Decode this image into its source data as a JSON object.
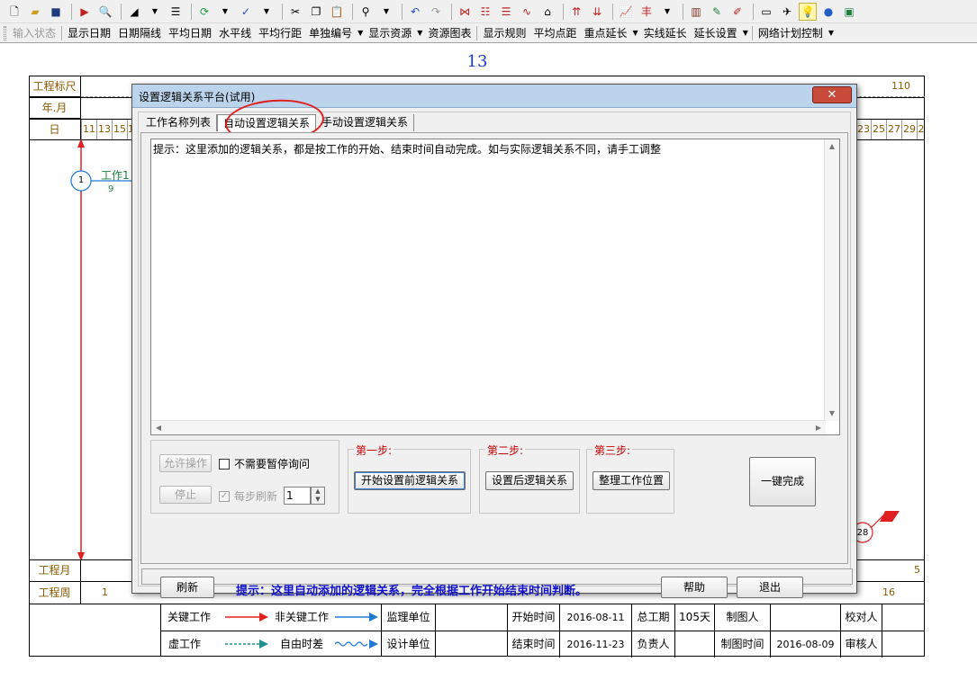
{
  "toolbar2": {
    "items": [
      "输入状态",
      "显示日期",
      "日期隔线",
      "平均日期",
      "水平线",
      "平均行距",
      "单独编号",
      "显示资源",
      "资源图表",
      "显示规则",
      "平均点距",
      "重点延长",
      "实线延长",
      "延长设置",
      "网络计划控制"
    ],
    "dropdown_arrow": "▼"
  },
  "page": {
    "number": "13"
  },
  "schedule": {
    "row_labels": {
      "ruler": "工程标尺",
      "year_month": "年.月",
      "day": "日",
      "month": "工程月",
      "week": "工程周"
    },
    "ruler_end": "110",
    "days_left": [
      "11",
      "13",
      "15",
      "1"
    ],
    "days_right": [
      "23",
      "25",
      "27",
      "29",
      "2"
    ],
    "week_first": "1",
    "week_last": "16",
    "month_last": "5",
    "task_label": "工作1",
    "task_duration": "9",
    "node_start": "1",
    "node_end": "28"
  },
  "legend": {
    "critical_work": "关键工作",
    "noncritical_work": "非关键工作",
    "dummy_work": "虚工作",
    "free_float": "自由时差",
    "supervisor_unit": "监理单位",
    "design_unit": "设计单位",
    "start_time_label": "开始时间",
    "start_time_value": "2016-08-11",
    "end_time_label": "结束时间",
    "end_time_value": "2016-11-23",
    "total_duration_label": "总工期",
    "total_duration_value": "105天",
    "responsible_label": "负责人",
    "drawer_label": "制图人",
    "draw_time_label": "制图时间",
    "draw_time_value": "2016-08-09",
    "checker_label": "校对人",
    "reviewer_label": "审核人"
  },
  "dialog": {
    "title": "设置逻辑关系平台(试用)",
    "close_glyph": "✕",
    "tabs": [
      "工作名称列表",
      "自动设置逻辑关系",
      "手动设置逻辑关系"
    ],
    "message": "提示：这里添加的逻辑关系，都是按工作的开始、结束时间自动完成。如与实际逻辑关系不同，请手工调整",
    "allow_button": "允许操作",
    "stop_button": "停止",
    "no_pause_checkbox": "不需要暂停询问",
    "refresh_each_step_checkbox": "每步刷新",
    "step_count": "1",
    "step1_label": "第一步:",
    "step1_button": "开始设置前逻辑关系",
    "step2_label": "第二步:",
    "step2_button": "设置后逻辑关系",
    "step3_label": "第三步:",
    "step3_button": "整理工作位置",
    "oneclick_button": "一键完成",
    "refresh_button": "刷新",
    "hint": "提示：这里自动添加的逻辑关系，完全根据工作开始结束时间判断。",
    "help_button": "帮助",
    "exit_button": "退出"
  },
  "colors": {
    "accent_blue": "#1a3ccc",
    "critical_red": "#e02020",
    "step_label_red": "#c00000",
    "schedule_text": "#8b5a00",
    "noncritical_blue": "#1e7ad6",
    "dummy_teal": "#1f8f8f"
  }
}
